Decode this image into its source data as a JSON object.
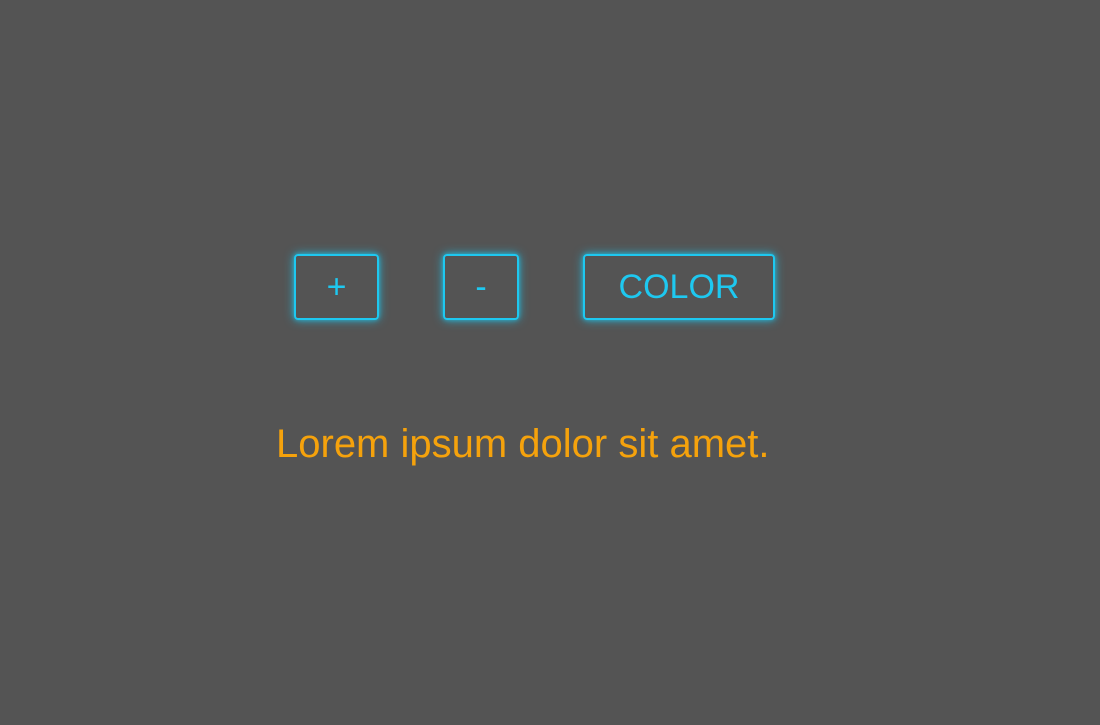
{
  "buttons": {
    "plus_label": "+",
    "minus_label": "-",
    "color_label": "COLOR"
  },
  "text": {
    "content": "Lorem ipsum dolor sit amet."
  },
  "colors": {
    "background": "#545454",
    "accent": "#1ec8f0",
    "text": "#f5a20c"
  }
}
